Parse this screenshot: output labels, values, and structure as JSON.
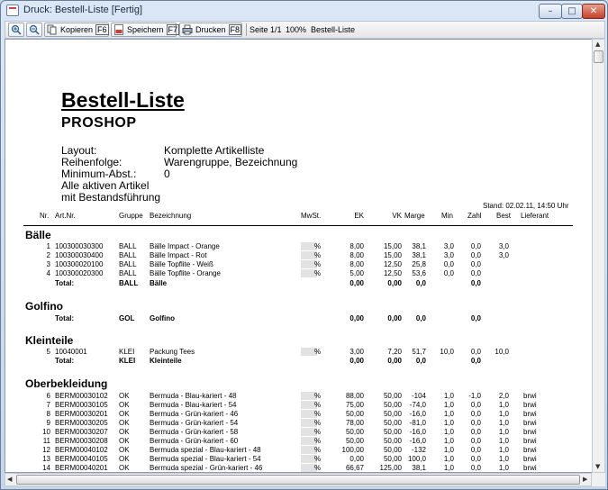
{
  "window": {
    "title": "Druck: Bestell-Liste [Fertig]",
    "controls": {
      "minimize": "–",
      "maximize": "□",
      "close": "✕"
    }
  },
  "toolbar": {
    "zoom_in_icon": "zoom-in-icon",
    "zoom_out_icon": "zoom-out-icon",
    "copy": {
      "label": "Kopieren",
      "key": "F6"
    },
    "save": {
      "label": "Speichern",
      "key": "F7"
    },
    "print": {
      "label": "Drucken",
      "key": "F8"
    },
    "page": "Seite 1/1",
    "zoom": "100%",
    "doc_name": "Bestell-Liste"
  },
  "report": {
    "title": "Bestell-Liste",
    "subtitle": "PROSHOP",
    "meta": [
      {
        "label": "Layout:",
        "value": "Komplette Artikelliste"
      },
      {
        "label": "Reihenfolge:",
        "value": "Warengruppe, Bezeichnung"
      },
      {
        "label": "Minimum-Abst.:",
        "value": "0"
      }
    ],
    "notes": [
      "Alle aktiven Artikel",
      "mit Bestandsführung"
    ],
    "stand": "Stand: 02.02.11, 14:50 Uhr",
    "columns": {
      "nr": "Nr.",
      "artnr": "Art.Nr.",
      "gruppe": "Gruppe",
      "bez": "Bezeichnung",
      "mwst": "MwSt.",
      "ek": "EK",
      "vk": "VK",
      "marge": "Marge",
      "min": "Min",
      "zahl": "Zahl",
      "best": "Best",
      "lief": "Lieferant"
    },
    "groups": [
      {
        "name": "Bälle",
        "rows": [
          {
            "nr": "1",
            "artnr": "100300030300",
            "gruppe": "BALL",
            "bez": "Bälle Impact - Orange",
            "mw": "%",
            "ek": "8,00",
            "vk": "15,00",
            "marge": "38,1",
            "min": "3,0",
            "zahl": "0,0",
            "best": "3,0",
            "lief": ""
          },
          {
            "nr": "2",
            "artnr": "100300030400",
            "gruppe": "BALL",
            "bez": "Bälle Impact - Rot",
            "mw": "%",
            "ek": "8,00",
            "vk": "15,00",
            "marge": "38,1",
            "min": "3,0",
            "zahl": "0,0",
            "best": "3,0",
            "lief": ""
          },
          {
            "nr": "3",
            "artnr": "100300020100",
            "gruppe": "BALL",
            "bez": "Bälle Topflite - Weiß",
            "mw": "%",
            "ek": "8,00",
            "vk": "12,50",
            "marge": "25,8",
            "min": "0,0",
            "zahl": "0,0",
            "best": "",
            "lief": ""
          },
          {
            "nr": "4",
            "artnr": "100300020300",
            "gruppe": "BALL",
            "bez": "Bälle Topflite - Orange",
            "mw": "%",
            "ek": "5,00",
            "vk": "12,50",
            "marge": "53,6",
            "min": "0,0",
            "zahl": "0,0",
            "best": "",
            "lief": ""
          }
        ],
        "total": {
          "label": "Total:",
          "gruppe": "BALL",
          "bez": "Bälle",
          "ek": "0,00",
          "vk": "0,00",
          "marge": "0,0",
          "zahl": "0,0"
        }
      },
      {
        "name": "Golfino",
        "rows": [],
        "total": {
          "label": "Total:",
          "gruppe": "GOL",
          "bez": "Golfino",
          "ek": "0,00",
          "vk": "0,00",
          "marge": "0,0",
          "zahl": "0,0"
        }
      },
      {
        "name": "Kleinteile",
        "rows": [
          {
            "nr": "5",
            "artnr": "10040001",
            "gruppe": "KLEI",
            "bez": "Packung Tees",
            "mw": "%",
            "ek": "3,00",
            "vk": "7,20",
            "marge": "51,7",
            "min": "10,0",
            "zahl": "0,0",
            "best": "10,0",
            "lief": ""
          }
        ],
        "total": {
          "label": "Total:",
          "gruppe": "KLEI",
          "bez": "Kleinteile",
          "ek": "0,00",
          "vk": "0,00",
          "marge": "0,0",
          "zahl": "0,0"
        }
      },
      {
        "name": "Oberbekleidung",
        "rows": [
          {
            "nr": "6",
            "artnr": "BERM00030102",
            "gruppe": "OK",
            "bez": "Bermuda - Blau-kariert - 48",
            "mw": "%",
            "ek": "88,00",
            "vk": "50,00",
            "marge": "-104",
            "min": "1,0",
            "zahl": "-1,0",
            "best": "2,0",
            "lief": "brwi"
          },
          {
            "nr": "7",
            "artnr": "BERM00030105",
            "gruppe": "OK",
            "bez": "Bermuda - Blau-kariert - 54",
            "mw": "%",
            "ek": "75,00",
            "vk": "50,00",
            "marge": "-74,0",
            "min": "1,0",
            "zahl": "0,0",
            "best": "1,0",
            "lief": "brwi"
          },
          {
            "nr": "8",
            "artnr": "BERM00030201",
            "gruppe": "OK",
            "bez": "Bermuda - Grün-kariert - 46",
            "mw": "%",
            "ek": "50,00",
            "vk": "50,00",
            "marge": "-16,0",
            "min": "1,0",
            "zahl": "0,0",
            "best": "1,0",
            "lief": "brwi"
          },
          {
            "nr": "9",
            "artnr": "BERM00030205",
            "gruppe": "OK",
            "bez": "Bermuda - Grün-kariert - 54",
            "mw": "%",
            "ek": "78,00",
            "vk": "50,00",
            "marge": "-81,0",
            "min": "1,0",
            "zahl": "0,0",
            "best": "1,0",
            "lief": "brwi"
          },
          {
            "nr": "10",
            "artnr": "BERM00030207",
            "gruppe": "OK",
            "bez": "Bermuda - Grün-kariert - 58",
            "mw": "%",
            "ek": "50,00",
            "vk": "50,00",
            "marge": "-16,0",
            "min": "1,0",
            "zahl": "0,0",
            "best": "1,0",
            "lief": "brwi"
          },
          {
            "nr": "11",
            "artnr": "BERM00030208",
            "gruppe": "OK",
            "bez": "Bermuda - Grün-kariert - 60",
            "mw": "%",
            "ek": "50,00",
            "vk": "50,00",
            "marge": "-16,0",
            "min": "1,0",
            "zahl": "0,0",
            "best": "1,0",
            "lief": "brwi"
          },
          {
            "nr": "12",
            "artnr": "BERM00040102",
            "gruppe": "OK",
            "bez": "Bermuda spezial - Blau-kariert - 48",
            "mw": "%",
            "ek": "100,00",
            "vk": "50,00",
            "marge": "-132",
            "min": "1,0",
            "zahl": "0,0",
            "best": "1,0",
            "lief": "brwi"
          },
          {
            "nr": "13",
            "artnr": "BERM00040105",
            "gruppe": "OK",
            "bez": "Bermuda spezial - Blau-kariert - 54",
            "mw": "%",
            "ek": "0,00",
            "vk": "50,00",
            "marge": "100,0",
            "min": "1,0",
            "zahl": "0,0",
            "best": "1,0",
            "lief": "brwi"
          },
          {
            "nr": "14",
            "artnr": "BERM00040201",
            "gruppe": "OK",
            "bez": "Bermuda spezial - Grün-kariert - 46",
            "mw": "%",
            "ek": "66,67",
            "vk": "125,00",
            "marge": "38,1",
            "min": "1,0",
            "zahl": "0,0",
            "best": "1,0",
            "lief": "brwi"
          }
        ]
      }
    ]
  }
}
